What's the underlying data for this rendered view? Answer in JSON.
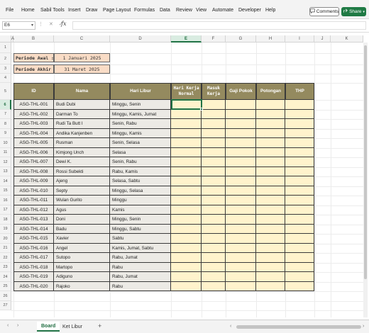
{
  "ribbon": {
    "tabs": [
      "File",
      "Home",
      "Sabil Tools",
      "Insert",
      "Draw",
      "Page Layout",
      "Formulas",
      "Data",
      "Review",
      "View",
      "Automate",
      "Developer",
      "Help"
    ],
    "comments_label": "Comments",
    "share_label": "Share",
    "comments_icon": "comment-icon",
    "share_icon": "share-icon"
  },
  "formula_bar": {
    "name_box": "E6",
    "formula": ""
  },
  "columns": [
    "A",
    "B",
    "C",
    "D",
    "E",
    "F",
    "G",
    "H",
    "I",
    "J",
    "K"
  ],
  "selected_column": "E",
  "selected_row": 6,
  "rows": [
    1,
    2,
    3,
    4,
    5,
    6,
    7,
    8,
    9,
    10,
    11,
    12,
    13,
    14,
    15,
    16,
    17,
    18,
    19,
    20,
    21,
    22,
    23,
    24,
    25,
    26,
    27
  ],
  "period": {
    "start_label": "Periode Awal :",
    "start_value": "1 Januari 2025",
    "end_label": "Periode Akhir :",
    "end_value": "31 Maret 2025"
  },
  "table": {
    "headers": [
      "ID",
      "Nama",
      "Hari Libur",
      "Hari Kerja Normal",
      "Masuk Kerja",
      "Gaji Pokok",
      "Potongan",
      "THP"
    ],
    "rows": [
      [
        "ASG-THL-001",
        "Budi Dubi",
        "Minggu, Senin"
      ],
      [
        "ASG-THL-002",
        "Darman To",
        "Minggu, Kamis, Jumat"
      ],
      [
        "ASG-THL-003",
        "Rudi Ta Butt I",
        "Senin, Rabu"
      ],
      [
        "ASG-THL-004",
        "Andika Kanjenben",
        "Minggu, Kamis"
      ],
      [
        "ASG-THL-005",
        "Rusman",
        "Senin, Selasa"
      ],
      [
        "ASG-THL-006",
        "Kimjong Unch",
        "Selasa"
      ],
      [
        "ASG-THL-007",
        "Dewi K.",
        "Senin, Rabu"
      ],
      [
        "ASG-THL-008",
        "Rossi Subekti",
        "Rabu, Kamis"
      ],
      [
        "ASG-THL-009",
        "Ajeng",
        "Selasa, Sabtu"
      ],
      [
        "ASG-THL-010",
        "Septy",
        "Minggu, Selasa"
      ],
      [
        "ASG-THL-011",
        "Wulan Gurito",
        "Minggu"
      ],
      [
        "ASG-THL-012",
        "Agus",
        "Kamis"
      ],
      [
        "ASG-THL-013",
        "Doni",
        "Minggu, Senin"
      ],
      [
        "ASG-THL-014",
        "Badu",
        "Minggu, Sabtu"
      ],
      [
        "ASG-THL-015",
        "Xavier",
        "Sabtu"
      ],
      [
        "ASG-THL-016",
        "Angel",
        "Kamis, Jumat, Sabtu"
      ],
      [
        "ASG-THL-017",
        "Sutopo",
        "Rabu, Jumat"
      ],
      [
        "ASG-THL-018",
        "Martopo",
        "Rabu"
      ],
      [
        "ASG-THL-019",
        "Adiguno",
        "Rabu, Jumat"
      ],
      [
        "ASG-THL-020",
        "Rajoko",
        "Rabu"
      ]
    ]
  },
  "sheets": {
    "tabs": [
      "Board",
      "Ket Libur"
    ],
    "active": "Board",
    "add_label": "+"
  },
  "colors": {
    "header_bg": "#948a5f",
    "period_bg": "#f9dcc6",
    "data_gray": "#eceae5",
    "data_yellow": "#fff3cc",
    "accent": "#217346"
  }
}
